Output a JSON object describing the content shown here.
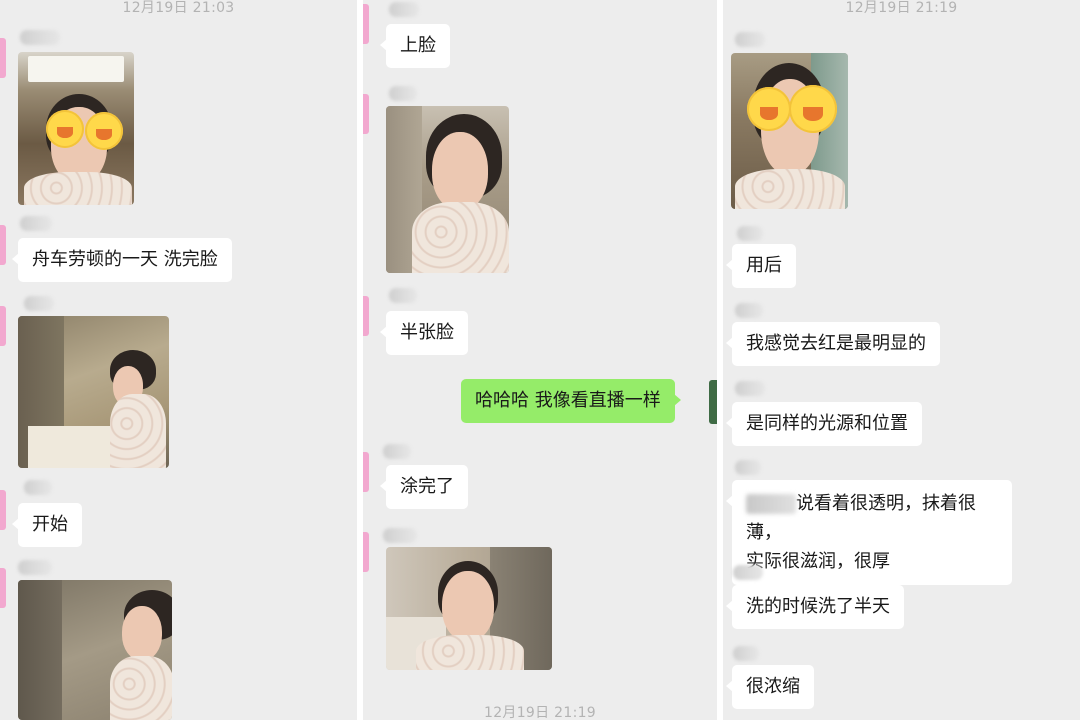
{
  "panel1": {
    "timestamp": "12月19日 21:03",
    "messages": [
      {
        "text": "舟车劳顿的一天 洗完脸"
      },
      {
        "text": "开始"
      }
    ]
  },
  "panel2": {
    "timestamp": "12月19日 21:19",
    "messages": [
      {
        "text": "上脸"
      },
      {
        "text": "半张脸"
      },
      {
        "text": "哈哈哈 我像看直播一样"
      },
      {
        "text": "涂完了"
      }
    ]
  },
  "panel3": {
    "timestamp": "12月19日 21:19",
    "messages": [
      {
        "text": "用后"
      },
      {
        "text": "我感觉去红是最明显的"
      },
      {
        "text": "是同样的光源和位置"
      },
      {
        "text_line1": "说看着很透明，抹着很薄，",
        "text_line2": "实际很滋润，很厚"
      },
      {
        "text": "洗的时候洗了半天"
      },
      {
        "text": "很浓缩"
      }
    ]
  },
  "colors": {
    "chat_background": "#ededed",
    "incoming_bubble": "#ffffff",
    "outgoing_bubble": "#95ec69",
    "pink_bar": "#f2a8cf"
  }
}
